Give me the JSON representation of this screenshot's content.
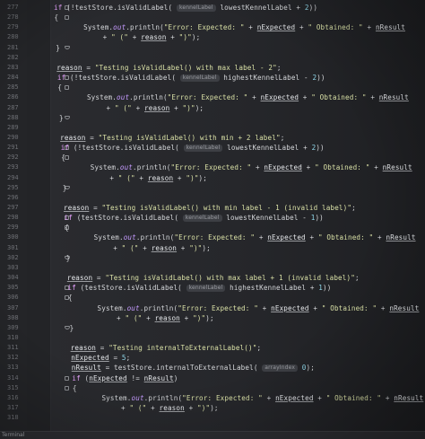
{
  "status_tab": "Terminal",
  "lines": [
    {
      "n": "277",
      "t": "if (!testStore.isValidLabel( kennelLabel lowestKennelLabel + 2))"
    },
    {
      "n": "278",
      "t": "{"
    },
    {
      "n": "279",
      "t": "System.out.println(\"Error: Expected: \" + nExpected + \" Obtained: \" + nResult"
    },
    {
      "n": "280",
      "t": "+ \" (\" + reason + \")\");"
    },
    {
      "n": "281",
      "t": "}"
    },
    {
      "n": "282",
      "t": ""
    },
    {
      "n": "283",
      "t": "reason = \"Testing isValidLabel() with max label - 2\";"
    },
    {
      "n": "284",
      "t": "if (!testStore.isValidLabel( kennelLabel highestKennelLabel - 2))"
    },
    {
      "n": "285",
      "t": "{"
    },
    {
      "n": "286",
      "t": "System.out.println(\"Error: Expected: \" + nExpected + \" Obtained: \" + nResult"
    },
    {
      "n": "287",
      "t": "+ \" (\" + reason + \")\");"
    },
    {
      "n": "288",
      "t": "}"
    },
    {
      "n": "289",
      "t": ""
    },
    {
      "n": "290",
      "t": "reason = \"Testing isValidLabel() with min + 2 label\";"
    },
    {
      "n": "291",
      "t": "if (!testStore.isValidLabel( kennelLabel lowestKennelLabel + 2))"
    },
    {
      "n": "292",
      "t": "{"
    },
    {
      "n": "293",
      "t": "System.out.println(\"Error: Expected: \" + nExpected + \" Obtained: \" + nResult"
    },
    {
      "n": "294",
      "t": "+ \" (\" + reason + \")\");"
    },
    {
      "n": "295",
      "t": "}"
    },
    {
      "n": "296",
      "t": ""
    },
    {
      "n": "297",
      "t": "reason = \"Testing isValidLabel() with min label - 1 (invalid label)\";"
    },
    {
      "n": "298",
      "t": "if (testStore.isValidLabel( kennelLabel lowestKennelLabel - 1))"
    },
    {
      "n": "299",
      "t": "{"
    },
    {
      "n": "300",
      "t": "System.out.println(\"Error: Expected: \" + nExpected + \" Obtained: \" + nResult"
    },
    {
      "n": "301",
      "t": "+ \" (\" + reason + \")\");"
    },
    {
      "n": "302",
      "t": "}"
    },
    {
      "n": "303",
      "t": ""
    },
    {
      "n": "304",
      "t": "reason = \"Testing isValidLabel() with max label + 1 (invalid label)\";"
    },
    {
      "n": "305",
      "t": "if (testStore.isValidLabel( kennelLabel highestKennelLabel + 1))"
    },
    {
      "n": "306",
      "t": "{"
    },
    {
      "n": "307",
      "t": "System.out.println(\"Error: Expected: \" + nExpected + \" Obtained: \" + nResult"
    },
    {
      "n": "308",
      "t": "+ \" (\" + reason + \")\");"
    },
    {
      "n": "309",
      "t": "}"
    },
    {
      "n": "310",
      "t": ""
    },
    {
      "n": "311",
      "t": "reason = \"Testing internalToExternalLabel()\";"
    },
    {
      "n": "312",
      "t": "nExpected = 5;"
    },
    {
      "n": "313",
      "t": "nResult = testStore.internalToExternalLabel( arrayIndex 0);"
    },
    {
      "n": "314",
      "t": "if (nExpected != nResult)"
    },
    {
      "n": "315",
      "t": "{"
    },
    {
      "n": "316",
      "t": "System.out.println(\"Error: Expected: \" + nExpected + \" Obtained: \" + nResult"
    },
    {
      "n": "317",
      "t": "+ \" (\" + reason + \")\");"
    },
    {
      "n": "318",
      "t": ""
    }
  ],
  "hints": {
    "kennel": "kennelLabel",
    "array": "arrayIndex"
  },
  "colors": {
    "keyword": "#e8a3ff",
    "string": "#d9e0a6",
    "number": "#8fd6e8",
    "field": "#c59bff"
  }
}
